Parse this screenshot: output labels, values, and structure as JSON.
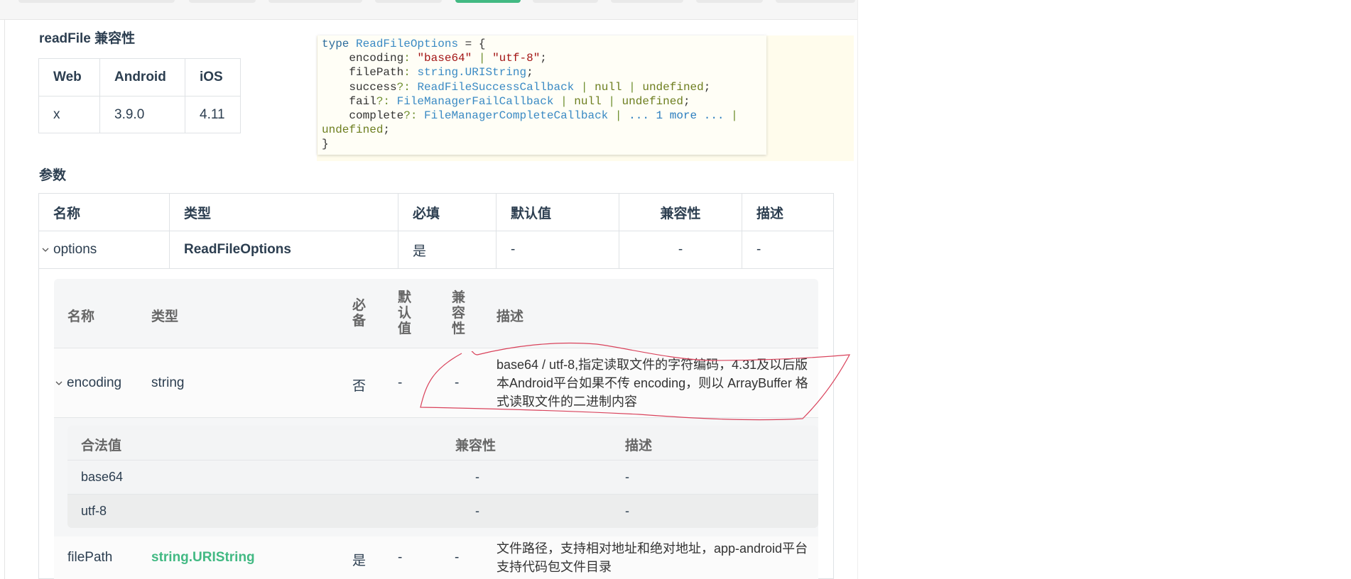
{
  "compat_section": {
    "title": "readFile 兼容性",
    "headers": [
      "Web",
      "Android",
      "iOS"
    ],
    "values": [
      "x",
      "3.9.0",
      "4.11"
    ]
  },
  "code_tooltip": {
    "line1_kw": "type",
    "line1_name": "ReadFileOptions",
    "line1_rest": " = {",
    "encoding_key": "encoding",
    "encoding_val1": "\"base64\"",
    "encoding_val2": "\"utf-8\"",
    "filepath_key": "filePath",
    "filepath_type": "string.URIString",
    "success_key": "success",
    "success_type": "ReadFileSuccessCallback",
    "fail_key": "fail",
    "fail_type": "FileManagerFailCallback",
    "complete_key": "complete",
    "complete_type": "FileManagerCompleteCallback",
    "more_text": "... 1 more ...",
    "null_kw": "null",
    "undefined_kw": "undefined",
    "closing": "}"
  },
  "params_section": {
    "title": "参数",
    "headers": [
      "名称",
      "类型",
      "必填",
      "默认值",
      "兼容性",
      "描述"
    ],
    "options_row": {
      "name": "options",
      "type": "ReadFileOptions",
      "required": "是",
      "default": "-",
      "compat": "-",
      "desc": "-"
    },
    "inner_headers": {
      "name": "名称",
      "type": "类型",
      "required": "必备",
      "default": "默认值",
      "compat": "兼容性",
      "desc": "描述"
    },
    "encoding_row": {
      "name": "encoding",
      "type": "string",
      "required": "否",
      "default": "-",
      "compat": "-",
      "desc": "base64 / utf-8,指定读取文件的字符编码，4.31及以后版本Android平台如果不传 encoding，则以 ArrayBuffer 格式读取文件的二进制内容"
    },
    "legal_values": {
      "headers": [
        "合法值",
        "兼容性",
        "描述"
      ],
      "rows": [
        {
          "value": "base64",
          "compat": "-",
          "desc": "-"
        },
        {
          "value": "utf-8",
          "compat": "-",
          "desc": "-"
        }
      ]
    },
    "filepath_row": {
      "name": "filePath",
      "type": "string.URIString",
      "required": "是",
      "default": "-",
      "compat": "-",
      "desc": "文件路径，支持相对地址和绝对地址，app-android平台支持代码包文件目录"
    }
  },
  "colors": {
    "accent_green": "#42b983",
    "annotation_red": "#d9425b"
  }
}
